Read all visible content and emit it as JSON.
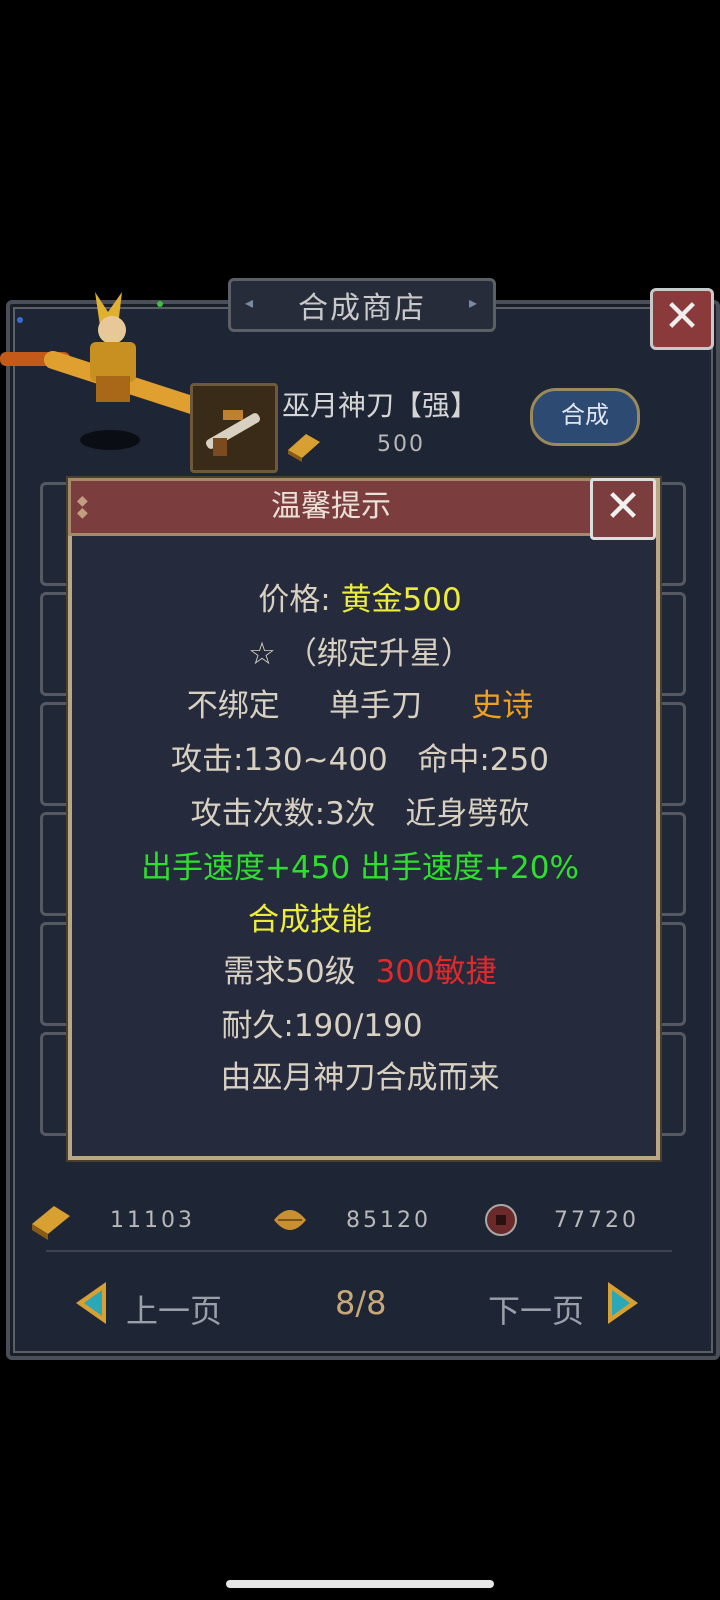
{
  "shop": {
    "title": "合成商店",
    "item": {
      "name": "巫月神刀【强】",
      "price": "500",
      "craft_label": "合成"
    },
    "currencies": [
      {
        "icon": "gold-ingot-icon",
        "value": "11103"
      },
      {
        "icon": "leaf-icon",
        "value": "85120"
      },
      {
        "icon": "coin-icon",
        "value": "77720"
      }
    ],
    "pager": {
      "prev_label": "上一页",
      "next_label": "下一页",
      "page": "8/8"
    }
  },
  "tip": {
    "title": "温馨提示",
    "price_label": "价格: ",
    "price_value": "黄金500",
    "star_line": "☆ （绑定升星）",
    "bind_status": "不绑定",
    "weapon_type": "单手刀",
    "quality": "史诗",
    "attack": "攻击:130~400",
    "hit": "命中:250",
    "attack_count": "攻击次数:3次",
    "attack_style": "近身劈砍",
    "bonus_1": "出手速度+450",
    "bonus_2": "出手速度+20%",
    "skill": "合成技能",
    "req_level": "需求50级",
    "req_agility": "300敏捷",
    "durability": "耐久:190/190",
    "source": "由巫月神刀合成而来"
  },
  "colors": {
    "price_value": "#ecec3c",
    "quality": "#f0a020",
    "bonus": "#2ee02e",
    "req_agility": "#e02a2a"
  }
}
